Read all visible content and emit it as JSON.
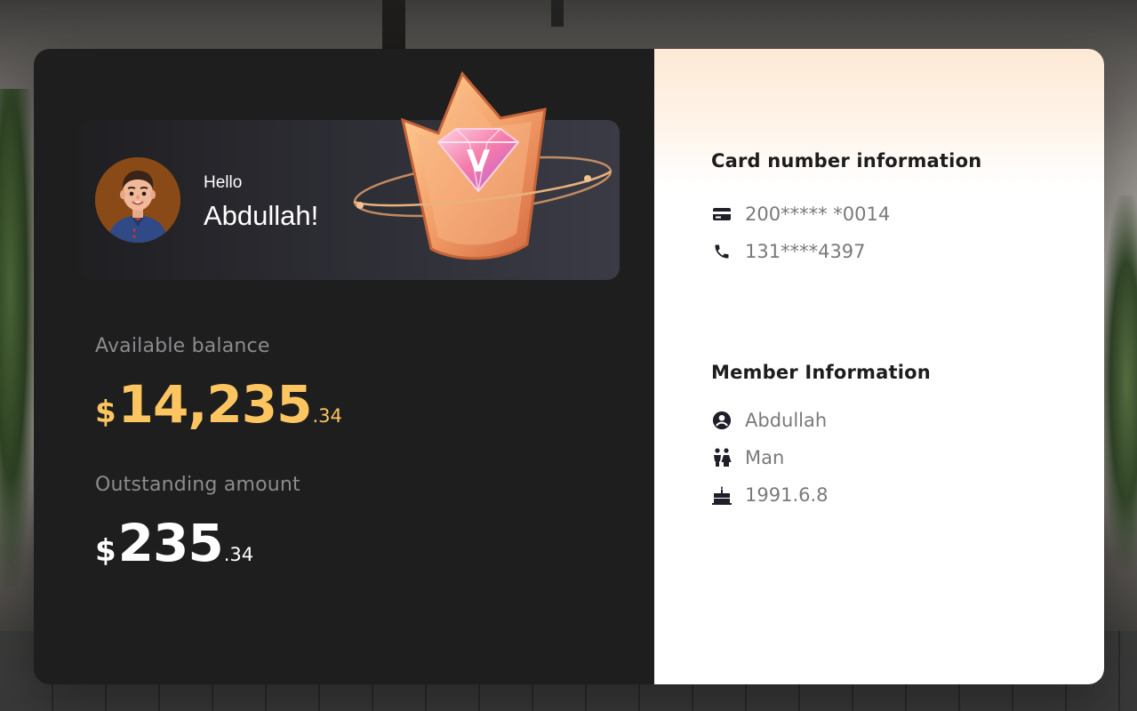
{
  "greeting": {
    "hello": "Hello",
    "name": "Abdullah!"
  },
  "balance": {
    "label": "Available balance",
    "currency": "$",
    "integer": "14,235",
    "decimal": ".34",
    "color": "#fcc560"
  },
  "outstanding": {
    "label": "Outstanding amount",
    "currency": "$",
    "integer": "235",
    "decimal": ".34"
  },
  "card_info": {
    "title": "Card number information",
    "items": [
      {
        "icon": "credit-card-icon",
        "text": "200***** *0014"
      },
      {
        "icon": "phone-icon",
        "text": "131****4397"
      }
    ]
  },
  "member_info": {
    "title": "Member Information",
    "items": [
      {
        "icon": "user-circle-icon",
        "text": "Abdullah"
      },
      {
        "icon": "gender-icon",
        "text": "Man"
      },
      {
        "icon": "birthday-cake-icon",
        "text": "1991.6.8"
      }
    ]
  }
}
